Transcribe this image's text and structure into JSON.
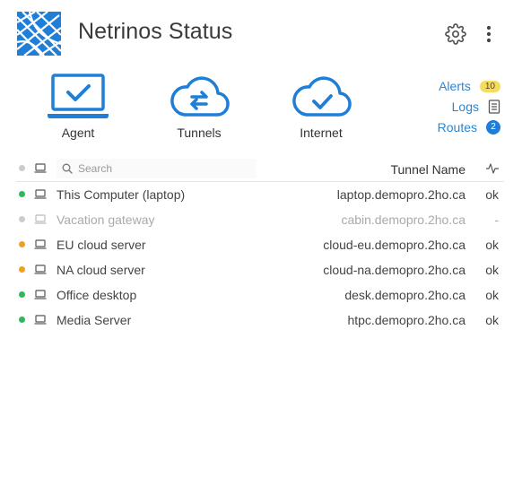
{
  "app": {
    "title": "Netrinos Status"
  },
  "status": [
    {
      "label": "Agent"
    },
    {
      "label": "Tunnels"
    },
    {
      "label": "Internet"
    }
  ],
  "links": {
    "alerts": {
      "label": "Alerts",
      "count": "10"
    },
    "logs": {
      "label": "Logs"
    },
    "routes": {
      "label": "Routes",
      "count": "2"
    }
  },
  "table": {
    "search_placeholder": "Search",
    "tunnel_header": "Tunnel Name",
    "rows": [
      {
        "name": "This Computer (laptop)",
        "tunnel": "laptop.demopro.2ho.ca",
        "status": "ok",
        "color": "#2eb85c"
      },
      {
        "name": "Vacation gateway",
        "tunnel": "cabin.demopro.2ho.ca",
        "status": "-",
        "color": "#cccccc"
      },
      {
        "name": "EU cloud server",
        "tunnel": "cloud-eu.demopro.2ho.ca",
        "status": "ok",
        "color": "#f0a020"
      },
      {
        "name": "NA cloud server",
        "tunnel": "cloud-na.demopro.2ho.ca",
        "status": "ok",
        "color": "#f0a020"
      },
      {
        "name": "Office desktop",
        "tunnel": "desk.demopro.2ho.ca",
        "status": "ok",
        "color": "#2eb85c"
      },
      {
        "name": "Media Server",
        "tunnel": "htpc.demopro.2ho.ca",
        "status": "ok",
        "color": "#2eb85c"
      }
    ]
  },
  "colors": {
    "accent": "#1f7fd8",
    "link": "#2a86d1",
    "badge_yellow": "#f7dc5a"
  }
}
